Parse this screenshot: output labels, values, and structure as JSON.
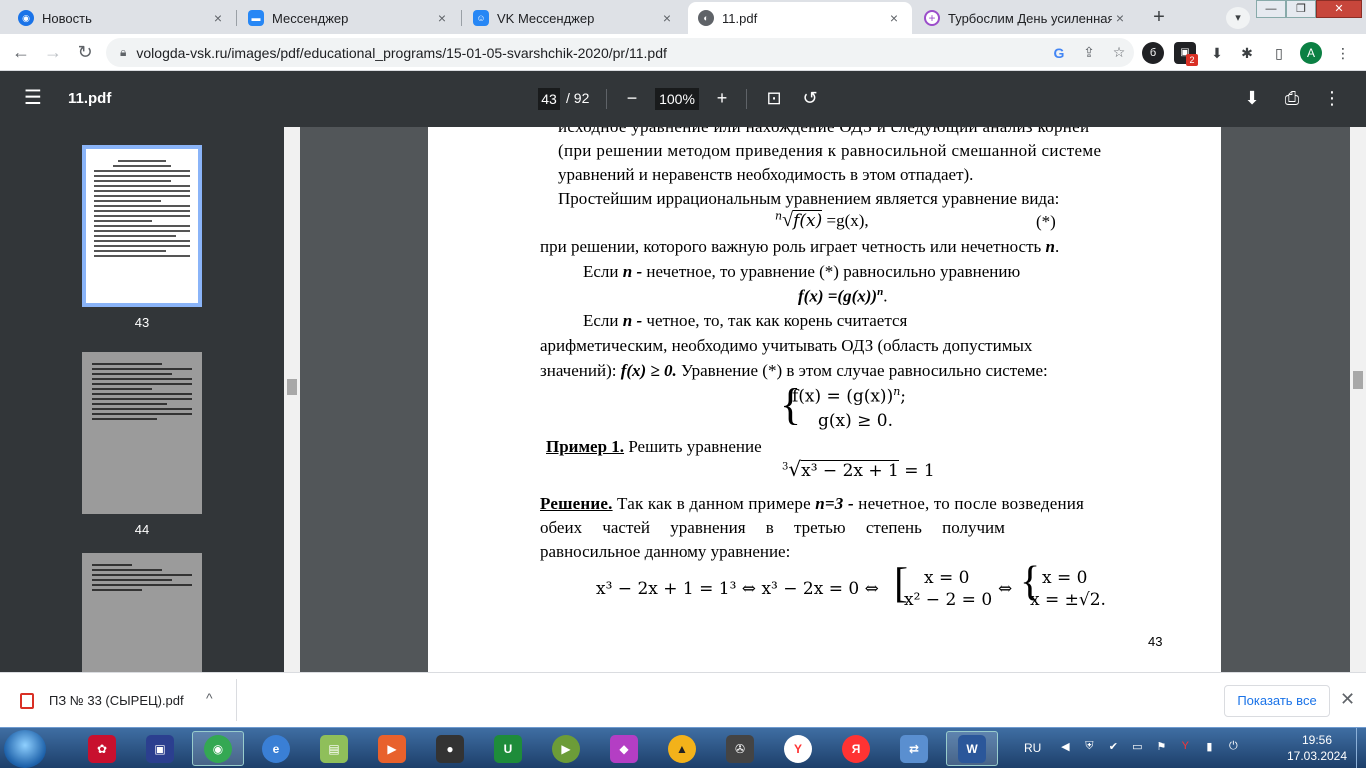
{
  "browser": {
    "tabs": [
      {
        "title": "Новость",
        "icon": "globe-icon",
        "color": "#1a73e8"
      },
      {
        "title": "Мессенджер",
        "icon": "messenger-icon",
        "color": "#2787f5"
      },
      {
        "title": "VK Мессенджер",
        "icon": "vk-icon",
        "color": "#2787f5"
      },
      {
        "title": "11.pdf",
        "icon": "pdf-globe-icon",
        "color": "#5f6368"
      },
      {
        "title": "Турбослим День усиленная ф",
        "icon": "plus-cross-icon",
        "color": "#9b4dca"
      }
    ],
    "new_tab_symbol": "+",
    "close_symbol": "×",
    "url": "vologda-vsk.ru/images/pdf/educational_programs/15-01-05-svarshchik-2020/pr/11.pdf",
    "extension_badge": "2",
    "profile_initial": "A"
  },
  "pdf": {
    "title": "11.pdf",
    "current_page": "43",
    "total_pages": "/ 92",
    "zoom": "100%"
  },
  "thumbnails": [
    {
      "label": "43"
    },
    {
      "label": "44"
    }
  ],
  "document": {
    "line1": "исходное уравнение или нахождение ОДЗ и следующий анализ корней",
    "line2": "(при решении методом приведения к равносильной смешанной системе",
    "line3": "уравнений и неравенств необходимость в этом отпадает).",
    "line4": "Простейшим иррациональным уравнением является уравнение вида:",
    "eq1_index": "n",
    "eq1_body": "f(x)",
    "eq1_rhs": "=g(x),",
    "eq1_mark": "(*)",
    "line5a": "при решении, которого важную роль играет четность или нечетность ",
    "line5b": "n",
    "line5c": ".",
    "line6a": "Если ",
    "line6b": "n -",
    "line6c": " нечетное, то уравнение (*) равносильно уравнению",
    "line7": "f(x)  =(g(x))",
    "line7_sup": "n",
    "line7_end": ".",
    "line8a": "Если ",
    "line8b": "n -",
    "line8c": " четное, то, так как корень считается",
    "line9": "арифметическим,  необходимо учитывать ОДЗ (область допустимых",
    "line10a": "значений): ",
    "line10b": "f(x) ≥ 0.",
    "line10c": " Уравнение (*) в этом случае равносильно системе:",
    "sys1": "f(x) = (g(x))",
    "sys1_sup": "n",
    "sys1_end": ";",
    "sys2": "g(x) ≥ 0.",
    "example_label": "Пример 1.",
    "example_text": " Решить уравнение",
    "eq2_index": "3",
    "eq2_body": "x³ − 2x + 1",
    "eq2_rhs": "= 1",
    "solution_label": "Решение.",
    "sol_line1a": " Так как в данном примере ",
    "sol_line1b": "n=3 -",
    "sol_line1c": " нечетное, то после возведения",
    "sol_line2": "обеих  частей  уравнения  в  третью  степень  получим",
    "sol_line3": "равносильное данному уравнение:",
    "final_eq": "x³ − 2x + 1 = 1³ ⇔ x³ − 2x = 0 ⇔",
    "final_b1": "x = 0",
    "final_b2": "x² − 2 = 0",
    "final_arrow": "⇔",
    "final_c1": "x = 0",
    "final_c2": "x = ±√2",
    "final_end": ".",
    "page_number": "43"
  },
  "downloads": {
    "file": "ПЗ № 33 (СЫРЕЦ).pdf",
    "show_all": "Показать все"
  },
  "taskbar": {
    "language": "RU",
    "time": "19:56",
    "date": "17.03.2024"
  }
}
